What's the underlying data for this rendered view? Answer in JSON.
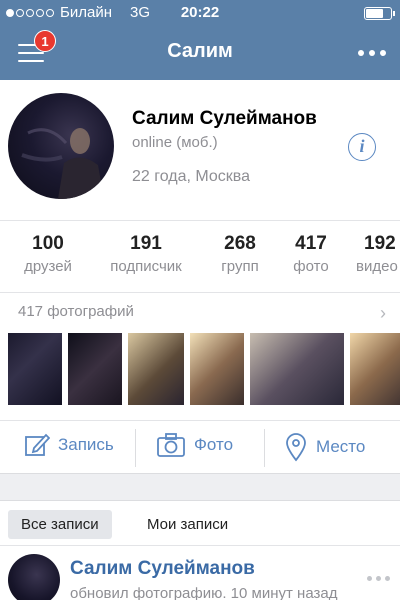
{
  "status_bar": {
    "carrier": "Билайн",
    "network": "3G",
    "time": "20:22",
    "signal_bars": 1,
    "battery_level": 0.75
  },
  "nav": {
    "title": "Салим",
    "notification_count": "1",
    "menu_icon": "hamburger-menu-icon",
    "more_icon": "more-dots-icon"
  },
  "profile": {
    "name": "Салим Сулейманов",
    "status": "online (моб.)",
    "age_city": "22 года, Москва",
    "info_icon": "i"
  },
  "counters": [
    {
      "value": "100",
      "label": "друзей"
    },
    {
      "value": "191",
      "label": "подписчик"
    },
    {
      "value": "268",
      "label": "групп"
    },
    {
      "value": "417",
      "label": "фото"
    },
    {
      "value": "192",
      "label": "видео"
    }
  ],
  "photos": {
    "title": "417 фотографий",
    "chevron": "›"
  },
  "actions": [
    {
      "label": "Запись",
      "icon": "edit-icon"
    },
    {
      "label": "Фото",
      "icon": "camera-icon"
    },
    {
      "label": "Место",
      "icon": "location-pin-icon"
    }
  ],
  "tabs": [
    {
      "label": "Все записи",
      "active": true
    },
    {
      "label": "Мои записи",
      "active": false
    }
  ],
  "post": {
    "author": "Салим Сулейманов",
    "description": "обновил фотографию. 10 минут назад"
  },
  "colors": {
    "header": "#5a80a8",
    "accent": "#5b88c2",
    "badge": "#e8382f"
  }
}
